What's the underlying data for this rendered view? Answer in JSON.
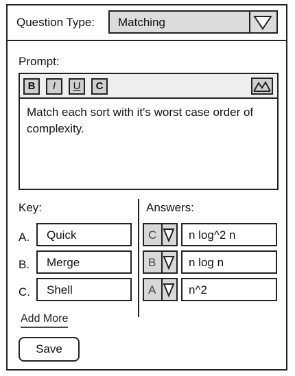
{
  "question_type": {
    "label": "Question Type:",
    "value": "Matching"
  },
  "prompt": {
    "label": "Prompt:",
    "toolbar": {
      "bold": "B",
      "italic": "I",
      "underline": "U",
      "clear": "C"
    },
    "text": "Match each sort with it's worst case order of complexity."
  },
  "key": {
    "label": "Key:",
    "items": [
      {
        "letter": "A.",
        "value": "Quick"
      },
      {
        "letter": "B.",
        "value": "Merge"
      },
      {
        "letter": "C.",
        "value": "Shell"
      }
    ]
  },
  "answers": {
    "label": "Answers:",
    "items": [
      {
        "match": "C",
        "value": "n log^2 n"
      },
      {
        "match": "B",
        "value": "n log n"
      },
      {
        "match": "A",
        "value": "n^2"
      }
    ]
  },
  "add_more_label": "Add More",
  "save_label": "Save",
  "icons": {
    "dropdown": "triangle-down-icon",
    "image": "image-icon"
  }
}
